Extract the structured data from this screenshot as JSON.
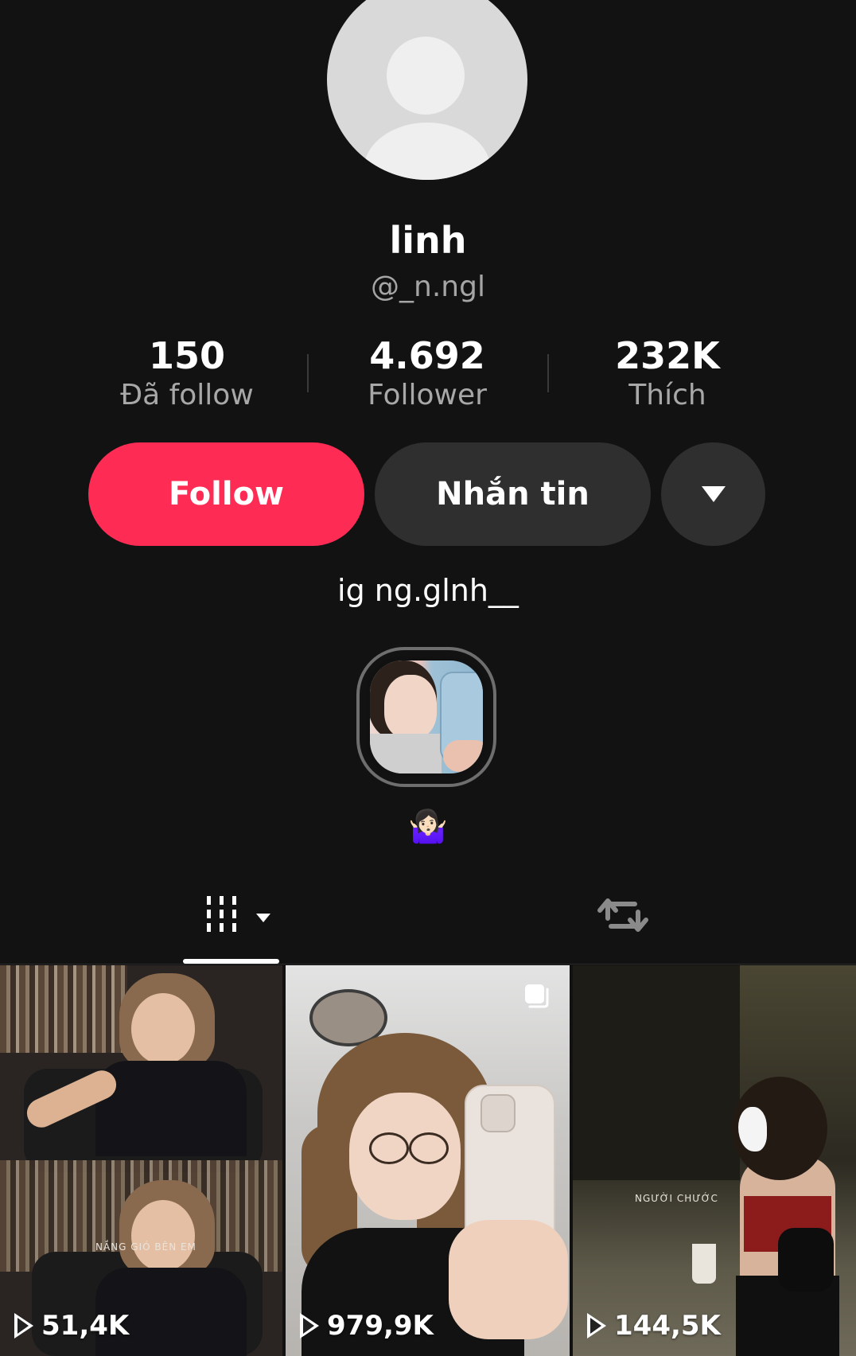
{
  "profile": {
    "name": "linh",
    "handle": "@_n.ngl",
    "bio": "ig ng.glnh__",
    "bio_emoji": "🤷🏻‍♀️"
  },
  "stats": [
    {
      "value": "150",
      "label": "Đã follow"
    },
    {
      "value": "4.692",
      "label": "Follower"
    },
    {
      "value": "232K",
      "label": "Thích"
    }
  ],
  "actions": {
    "follow": "Follow",
    "message": "Nhắn tin",
    "more_icon": "caret-down-icon"
  },
  "tabs": {
    "videos_icon": "grid-icon",
    "reposts_icon": "repost-icon",
    "selected": "videos"
  },
  "videos": [
    {
      "views": "51,4K",
      "overlay": "NẮNG GIÓ BÊN EM"
    },
    {
      "views": "979,9K",
      "overlay": ""
    },
    {
      "views": "144,5K",
      "overlay": "NGƯỜI CHƯỚC"
    }
  ],
  "colors": {
    "background": "#121212",
    "follow_button": "#fe2c55",
    "secondary_button": "#2f2f2f",
    "muted_text": "#a8a8a8"
  }
}
